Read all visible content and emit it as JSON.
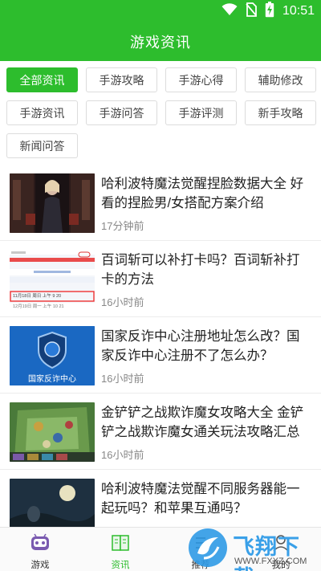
{
  "status": {
    "time": "10:51",
    "icons": [
      "wifi-icon",
      "no-sim-icon",
      "battery-charging-icon"
    ]
  },
  "header": {
    "title": "游戏资讯"
  },
  "tags": [
    {
      "label": "全部资讯",
      "active": true
    },
    {
      "label": "手游攻略",
      "active": false
    },
    {
      "label": "手游心得",
      "active": false
    },
    {
      "label": "辅助修改",
      "active": false
    },
    {
      "label": "手游资讯",
      "active": false
    },
    {
      "label": "手游问答",
      "active": false
    },
    {
      "label": "手游评测",
      "active": false
    },
    {
      "label": "新手攻略",
      "active": false
    },
    {
      "label": "新闻问答",
      "active": false
    }
  ],
  "articles": [
    {
      "title": "哈利波特魔法觉醒捏脸数据大全 好看的捏脸男/女搭配方案介绍",
      "time": "17分钟前"
    },
    {
      "title": "百词斩可以补打卡吗？百词斩补打卡的方法",
      "time": "16小时前"
    },
    {
      "title": "国家反诈中心注册地址怎么改？国家反诈中心注册不了怎么办？",
      "time": "16小时前",
      "thumb_caption": "国家反诈中心"
    },
    {
      "title": "金铲铲之战欺诈魔女攻略大全 金铲铲之战欺诈魔女通关玩法攻略汇总",
      "time": "16小时前"
    },
    {
      "title": "哈利波特魔法觉醒不同服务器能一起玩吗？和苹果互通吗？",
      "time": ""
    }
  ],
  "thumb2": {
    "row1": "11月18日 周日  上午  9  20",
    "row2": "12月19日 周一  上午  10 21"
  },
  "tabbar": [
    {
      "label": "游戏",
      "icon": "gamepad-icon",
      "active": false
    },
    {
      "label": "资讯",
      "icon": "news-icon",
      "active": true
    },
    {
      "label": "推荐",
      "icon": "recommend-icon",
      "active": false
    },
    {
      "label": "我的",
      "icon": "user-icon",
      "active": false
    }
  ],
  "watermark": {
    "text": "飞翔下载",
    "url": "WWW.FXXZ.COM"
  },
  "colors": {
    "accent": "#2dbd2d"
  }
}
